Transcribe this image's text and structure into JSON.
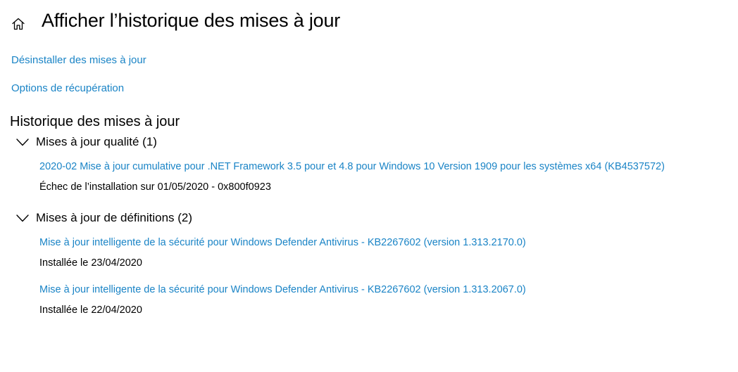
{
  "header": {
    "home_icon": "home-icon",
    "title": "Afficher l’historique des mises à jour"
  },
  "links": {
    "uninstall": "Désinstaller des mises à jour",
    "recovery": "Options de récupération"
  },
  "history": {
    "section_title": "Historique des mises à jour",
    "groups": [
      {
        "title": "Mises à jour qualité (1)",
        "expanded": true,
        "entries": [
          {
            "title": "2020-02 Mise à jour cumulative pour .NET Framework 3.5 pour et 4.8 pour Windows 10 Version 1909 pour les systèmes x64 (KB4537572)",
            "status": "Échec de l’installation sur 01/05/2020 - 0x800f0923"
          }
        ]
      },
      {
        "title": "Mises à jour de définitions (2)",
        "expanded": true,
        "entries": [
          {
            "title": "Mise à jour intelligente de la sécurité pour Windows Defender Antivirus - KB2267602 (version 1.313.2170.0)",
            "status": "Installée le 23/04/2020"
          },
          {
            "title": "Mise à jour intelligente de la sécurité pour Windows Defender Antivirus - KB2267602 (version 1.313.2067.0)",
            "status": "Installée le 22/04/2020"
          }
        ]
      }
    ]
  },
  "colors": {
    "link": "#1a84c6",
    "text": "#000000",
    "background": "#ffffff"
  }
}
